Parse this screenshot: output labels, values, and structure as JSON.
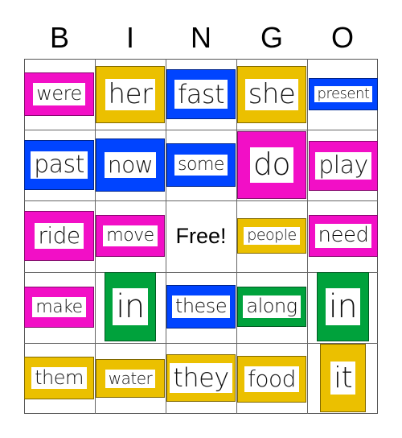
{
  "header": [
    "B",
    "I",
    "N",
    "G",
    "O"
  ],
  "free_label": "Free!",
  "colors": {
    "pink": "#f20fc6",
    "yellow": "#ebc000",
    "blue": "#0044ff",
    "green": "#00a23c"
  },
  "cells": [
    {
      "word": "were",
      "color": "pink"
    },
    {
      "word": "her",
      "color": "yellow"
    },
    {
      "word": "fast",
      "color": "blue"
    },
    {
      "word": "she",
      "color": "yellow"
    },
    {
      "word": "present",
      "color": "blue"
    },
    {
      "word": "past",
      "color": "blue"
    },
    {
      "word": "now",
      "color": "blue"
    },
    {
      "word": "some",
      "color": "blue"
    },
    {
      "word": "do",
      "color": "pink"
    },
    {
      "word": "play",
      "color": "pink"
    },
    {
      "word": "ride",
      "color": "pink"
    },
    {
      "word": "move",
      "color": "pink"
    },
    {
      "word": "",
      "color": ""
    },
    {
      "word": "people",
      "color": "yellow"
    },
    {
      "word": "need",
      "color": "pink"
    },
    {
      "word": "make",
      "color": "pink"
    },
    {
      "word": "in",
      "color": "green"
    },
    {
      "word": "these",
      "color": "blue"
    },
    {
      "word": "along",
      "color": "green"
    },
    {
      "word": "in",
      "color": "green"
    },
    {
      "word": "them",
      "color": "yellow"
    },
    {
      "word": "water",
      "color": "yellow"
    },
    {
      "word": "they",
      "color": "yellow"
    },
    {
      "word": "food",
      "color": "yellow"
    },
    {
      "word": "it",
      "color": "yellow"
    }
  ]
}
